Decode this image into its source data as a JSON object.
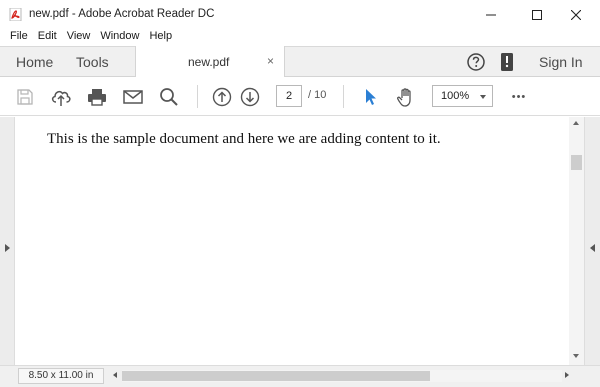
{
  "window": {
    "title": "new.pdf - Adobe Acrobat Reader DC",
    "icon": "pdf-icon",
    "controls": [
      "minimize-icon",
      "maximize-icon",
      "close-icon"
    ]
  },
  "menu": {
    "items": [
      "File",
      "Edit",
      "View",
      "Window",
      "Help"
    ]
  },
  "tabs": {
    "home": "Home",
    "tools": "Tools",
    "document": "new.pdf",
    "document_close": "×",
    "signin": "Sign In",
    "icons": [
      "help-icon",
      "mobile-icon"
    ]
  },
  "toolbar": {
    "icons": [
      "save-icon",
      "upload-icon",
      "print-icon",
      "email-icon",
      "search-icon",
      "previous-page-icon",
      "next-page-icon",
      "select-tool-icon",
      "hand-tool-icon",
      "more-icon"
    ],
    "current_page": "2",
    "total_pages": "/ 10",
    "zoom": "100%",
    "more_label": "•••"
  },
  "document": {
    "text": "This is the sample document and here we are adding content to it."
  },
  "status": {
    "page_size": "8.50 x 11.00 in"
  },
  "colors": {
    "accent": "#2b7fd4",
    "pdf_red": "#d4241c"
  }
}
